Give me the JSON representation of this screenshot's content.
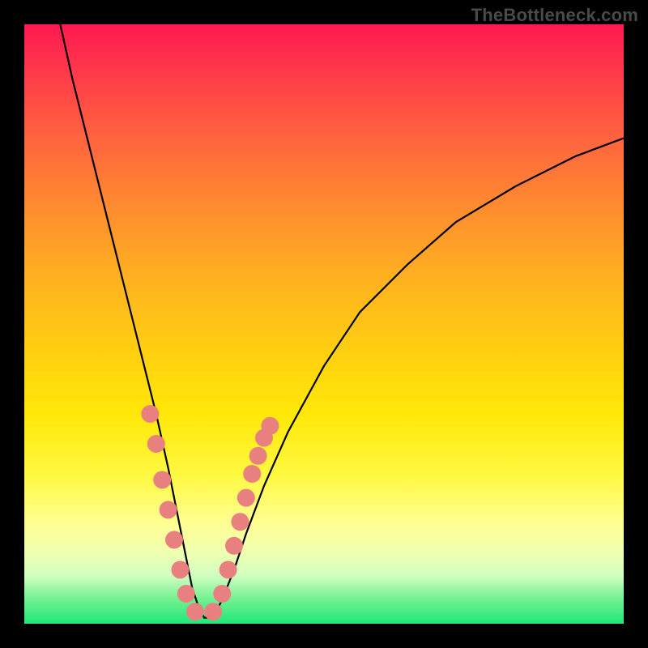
{
  "attribution": "TheBottleneck.com",
  "chart_data": {
    "type": "line",
    "title": "",
    "xlabel": "",
    "ylabel": "",
    "xlim": [
      0,
      100
    ],
    "ylim": [
      0,
      100
    ],
    "curve": {
      "name": "bottleneck-profile",
      "x": [
        6,
        8,
        10,
        12,
        14,
        16,
        18,
        20,
        22,
        24,
        25,
        26,
        27,
        28,
        29,
        30,
        31,
        32,
        33,
        35,
        37,
        40,
        44,
        50,
        56,
        64,
        72,
        82,
        92,
        100
      ],
      "y": [
        100,
        91,
        83,
        75,
        67,
        59,
        51,
        43,
        35,
        26,
        21,
        16,
        11,
        6,
        3,
        1,
        1,
        2,
        4,
        9,
        15,
        23,
        32,
        43,
        52,
        60,
        67,
        73,
        78,
        81
      ]
    },
    "markers_left": {
      "name": "left-cluster",
      "x": [
        21.0,
        22.0,
        23.0,
        24.0,
        25.0,
        26.0,
        27.0,
        28.5
      ],
      "y": [
        35,
        30,
        24,
        19,
        14,
        9,
        5,
        2
      ]
    },
    "markers_right": {
      "name": "right-cluster",
      "x": [
        31.5,
        33.0,
        34.0,
        35.0,
        36.0,
        37.0,
        38.0,
        39.0,
        40.0,
        41.0
      ],
      "y": [
        2,
        5,
        9,
        13,
        17,
        21,
        25,
        28,
        31,
        33
      ]
    },
    "marker_color": "#e98080",
    "curve_color": "#000000"
  }
}
